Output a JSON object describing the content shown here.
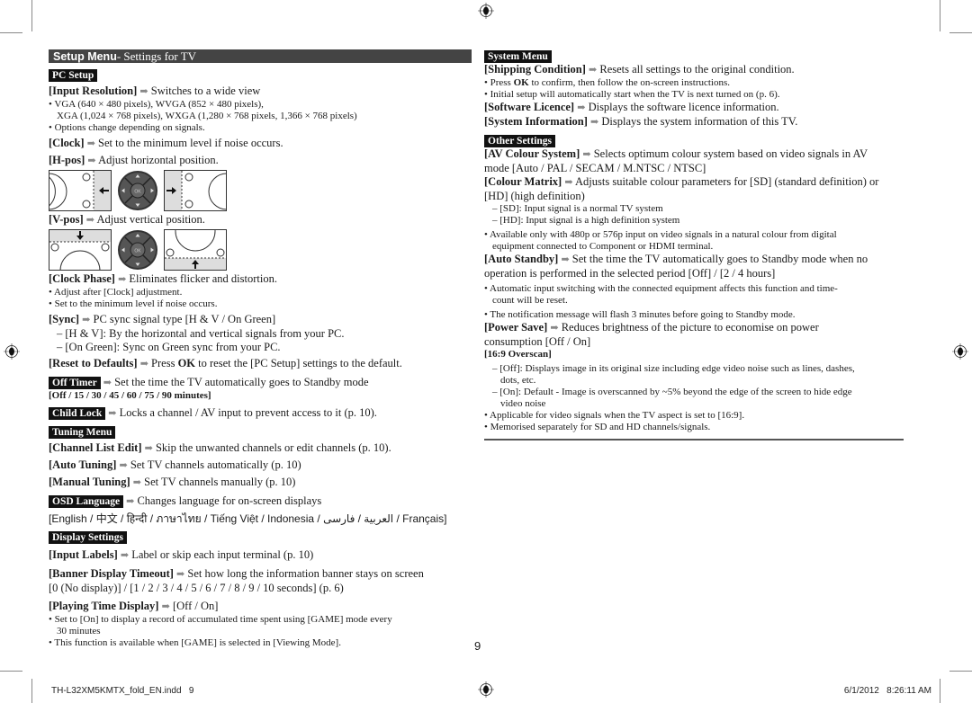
{
  "header": {
    "title_bold": "Setup Menu",
    "title_rest": "- Settings for TV"
  },
  "left": {
    "pc_setup": {
      "tag": "PC Setup",
      "input_resolution": {
        "name": "[Input Resolution]",
        "desc": "Switches to a wide view"
      },
      "res_bullet1": "• VGA (640 × 480 pixels), WVGA (852 × 480 pixels),",
      "res_bullet1b": "XGA (1,024 × 768 pixels), WXGA (1,280 × 768 pixels, 1,366 × 768 pixels)",
      "res_bullet2": "• Options change depending on signals.",
      "clock": {
        "name": "[Clock]",
        "desc": "Set to the minimum level if noise occurs."
      },
      "hpos": {
        "name": "[H-pos]",
        "desc": "Adjust horizontal position."
      },
      "vpos": {
        "name": "[V-pos]",
        "desc": "Adjust vertical position."
      },
      "clock_phase": {
        "name": "[Clock Phase]",
        "desc": "Eliminates flicker and distortion."
      },
      "cp_bullet1": "• Adjust after [Clock] adjustment.",
      "cp_bullet2": "• Set to the minimum level if noise occurs.",
      "sync": {
        "name": "[Sync]",
        "desc": "PC sync signal type [H & V / On Green]"
      },
      "sync_sub1": "– [H & V]: By the horizontal and vertical signals from your PC.",
      "sync_sub2": "– [On Green]: Sync on Green sync from your PC.",
      "reset": {
        "name": "[Reset to Defaults]",
        "desc_pre": "Press ",
        "desc_bold": "OK",
        "desc_post": " to reset the [PC Setup] settings to the default."
      },
      "ok_label": "OK"
    },
    "off_timer": {
      "tag": "Off Timer",
      "desc": "Set the time the TV automatically goes to Standby mode",
      "options": "[Off / 15 / 30 / 45 / 60 / 75 / 90 minutes]"
    },
    "child_lock": {
      "tag": "Child Lock",
      "desc": "Locks a channel / AV input to prevent access to it (p. 10)."
    },
    "tuning_menu": {
      "tag": "Tuning Menu",
      "channel_list_edit": {
        "name": "[Channel List Edit]",
        "desc": "Skip the unwanted channels or edit channels (p. 10)."
      },
      "auto_tuning": {
        "name": "[Auto Tuning]",
        "desc": "Set TV channels automatically (p. 10)"
      },
      "manual_tuning": {
        "name": "[Manual Tuning]",
        "desc": "Set TV channels manually (p. 10)"
      }
    },
    "osd_language": {
      "tag": "OSD Language",
      "desc": "Changes language for on-screen displays",
      "options": "[English / 中文 / हिन्दी / ภาษาไทย / Tiếng Việt / Indonesia / العربية / فارسی / Français]"
    },
    "display_settings": {
      "tag": "Display Settings",
      "input_labels": {
        "name": "[Input Labels]",
        "desc": "Label or skip each input terminal (p. 10)"
      },
      "banner_timeout": {
        "name": "[Banner Display Timeout]",
        "desc": "Set how long the information banner stays on screen",
        "options": "[0 (No display)] / [1 / 2 / 3 / 4 / 5 / 6 / 7 / 8 / 9 / 10 seconds] (p. 6)"
      },
      "playing_time": {
        "name": "[Playing Time Display]",
        "desc": "[Off / On]"
      },
      "pt_bullet1": "• Set to [On] to display a record of accumulated time spent using [GAME] mode every",
      "pt_bullet1b": "30 minutes",
      "pt_bullet2": "• This function is available when [GAME] is selected in [Viewing Mode]."
    }
  },
  "right": {
    "system_menu": {
      "tag": "System Menu",
      "shipping": {
        "name": "[Shipping Condition]",
        "desc": "Resets all settings to the original condition."
      },
      "sh_bullet1_pre": "• Press ",
      "sh_bullet1_bold": "OK",
      "sh_bullet1_post": " to confirm, then follow the on-screen instructions.",
      "sh_bullet2": "• Initial setup will automatically start when the TV is next turned on (p. 6).",
      "software": {
        "name": "[Software Licence]",
        "desc": "Displays the software licence information."
      },
      "sysinfo": {
        "name": "[System Information]",
        "desc": "Displays the system information of this TV."
      }
    },
    "other_settings": {
      "tag": "Other Settings",
      "av_colour": {
        "name": "[AV Colour System]",
        "desc": "Selects optimum colour system based on video signals in AV",
        "desc2": "mode [Auto / PAL / SECAM / M.NTSC / NTSC]"
      },
      "colour_matrix": {
        "name": "[Colour Matrix]",
        "desc": "Adjusts suitable colour parameters for [SD] (standard definition) or",
        "desc2": "[HD] (high definition)"
      },
      "cm_sub1": "– [SD]: Input signal is a normal TV system",
      "cm_sub2": "– [HD]: Input signal is a high definition system",
      "cm_bullet1": "• Available only with 480p or 576p input on video signals in a natural colour from digital",
      "cm_bullet1b": "equipment connected to Component or HDMI terminal.",
      "auto_standby": {
        "name": "[Auto Standby]",
        "desc": "Set the time the TV automatically goes to Standby mode when no",
        "desc2": "operation is performed in the selected period [Off] / [2 / 4 hours]"
      },
      "as_bullet1": "• Automatic input switching with the connected equipment affects this function and time-",
      "as_bullet1b": "count will be reset.",
      "as_bullet2": "• The notification message will flash 3 minutes before going to Standby mode.",
      "power_save": {
        "name": "[Power Save]",
        "desc": "Reduces brightness of the picture to economise on power",
        "desc2": "consumption [Off / On]"
      },
      "overscan": {
        "name": "[16:9 Overscan]"
      },
      "os_sub1": "– [Off]: Displays image in its original size including edge video noise such as lines, dashes,",
      "os_sub1b": "dots, etc.",
      "os_sub2": "– [On]: Default - Image is overscanned by ~5% beyond the edge of the screen to hide edge",
      "os_sub2b": "video noise",
      "os_bullet1": "• Applicable for video signals when the TV aspect is set to [16:9].",
      "os_bullet2": "• Memorised separately for SD and HD channels/signals."
    }
  },
  "page_number": "9",
  "footer": {
    "filename": "TH-L32XM5KMTX_fold_EN.indd   9",
    "timestamp": "6/1/2012   8:26:11 AM"
  },
  "icons": {
    "arrow": "➡"
  }
}
